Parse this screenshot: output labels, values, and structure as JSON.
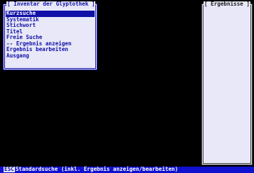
{
  "menu": {
    "title": "[ Inventar der Glyptothek ]",
    "items": [
      {
        "label": "Kurzsuche",
        "selected": true
      },
      {
        "label": "Systematik"
      },
      {
        "label": "Stichwort"
      },
      {
        "label": "Titel"
      },
      {
        "label": "Freie Suche"
      },
      {
        "label": "-- Ergebnis anzeigen"
      },
      {
        "label": "Ergebnis bearbeiten"
      },
      {
        "label": "Ausgang"
      }
    ]
  },
  "results": {
    "title": "[ Ergebnisse ]"
  },
  "status_bar": {
    "key": "ESC",
    "text": "Standardsuche (inkl. Ergebnis anzeigen/bearbeiten)"
  },
  "colors": {
    "background": "#000000",
    "panel": "#e8e8f8",
    "accent": "#1010a8",
    "status_bar": "#1010d0"
  }
}
